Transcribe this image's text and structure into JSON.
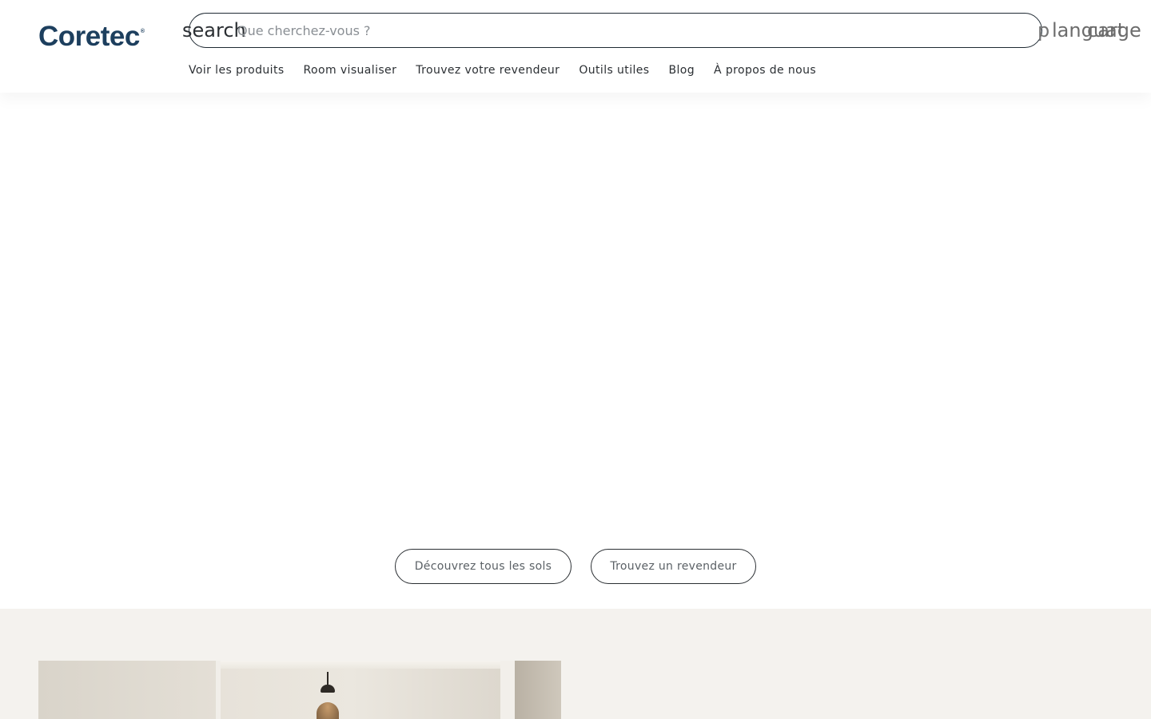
{
  "header": {
    "logo_text": "Coretec",
    "logo_reg": "®",
    "search": {
      "icon_text": "search",
      "placeholder": "Que cherchez-vous ?",
      "value": ""
    },
    "utility": {
      "account_text": "p",
      "language_text": "language",
      "cart_text": "cart"
    }
  },
  "nav": {
    "items": [
      {
        "label": "Voir les produits"
      },
      {
        "label": "Room visualiser"
      },
      {
        "label": "Trouvez votre revendeur"
      },
      {
        "label": "Outils utiles"
      },
      {
        "label": "Blog"
      },
      {
        "label": "À propos de nous"
      }
    ]
  },
  "hero": {
    "cta_primary": "Découvrez tous les sols",
    "cta_secondary": "Trouvez un revendeur"
  },
  "colors": {
    "brand": "#1d3f5e",
    "text": "#2b2f33",
    "section_bg": "#f4f2ee"
  }
}
